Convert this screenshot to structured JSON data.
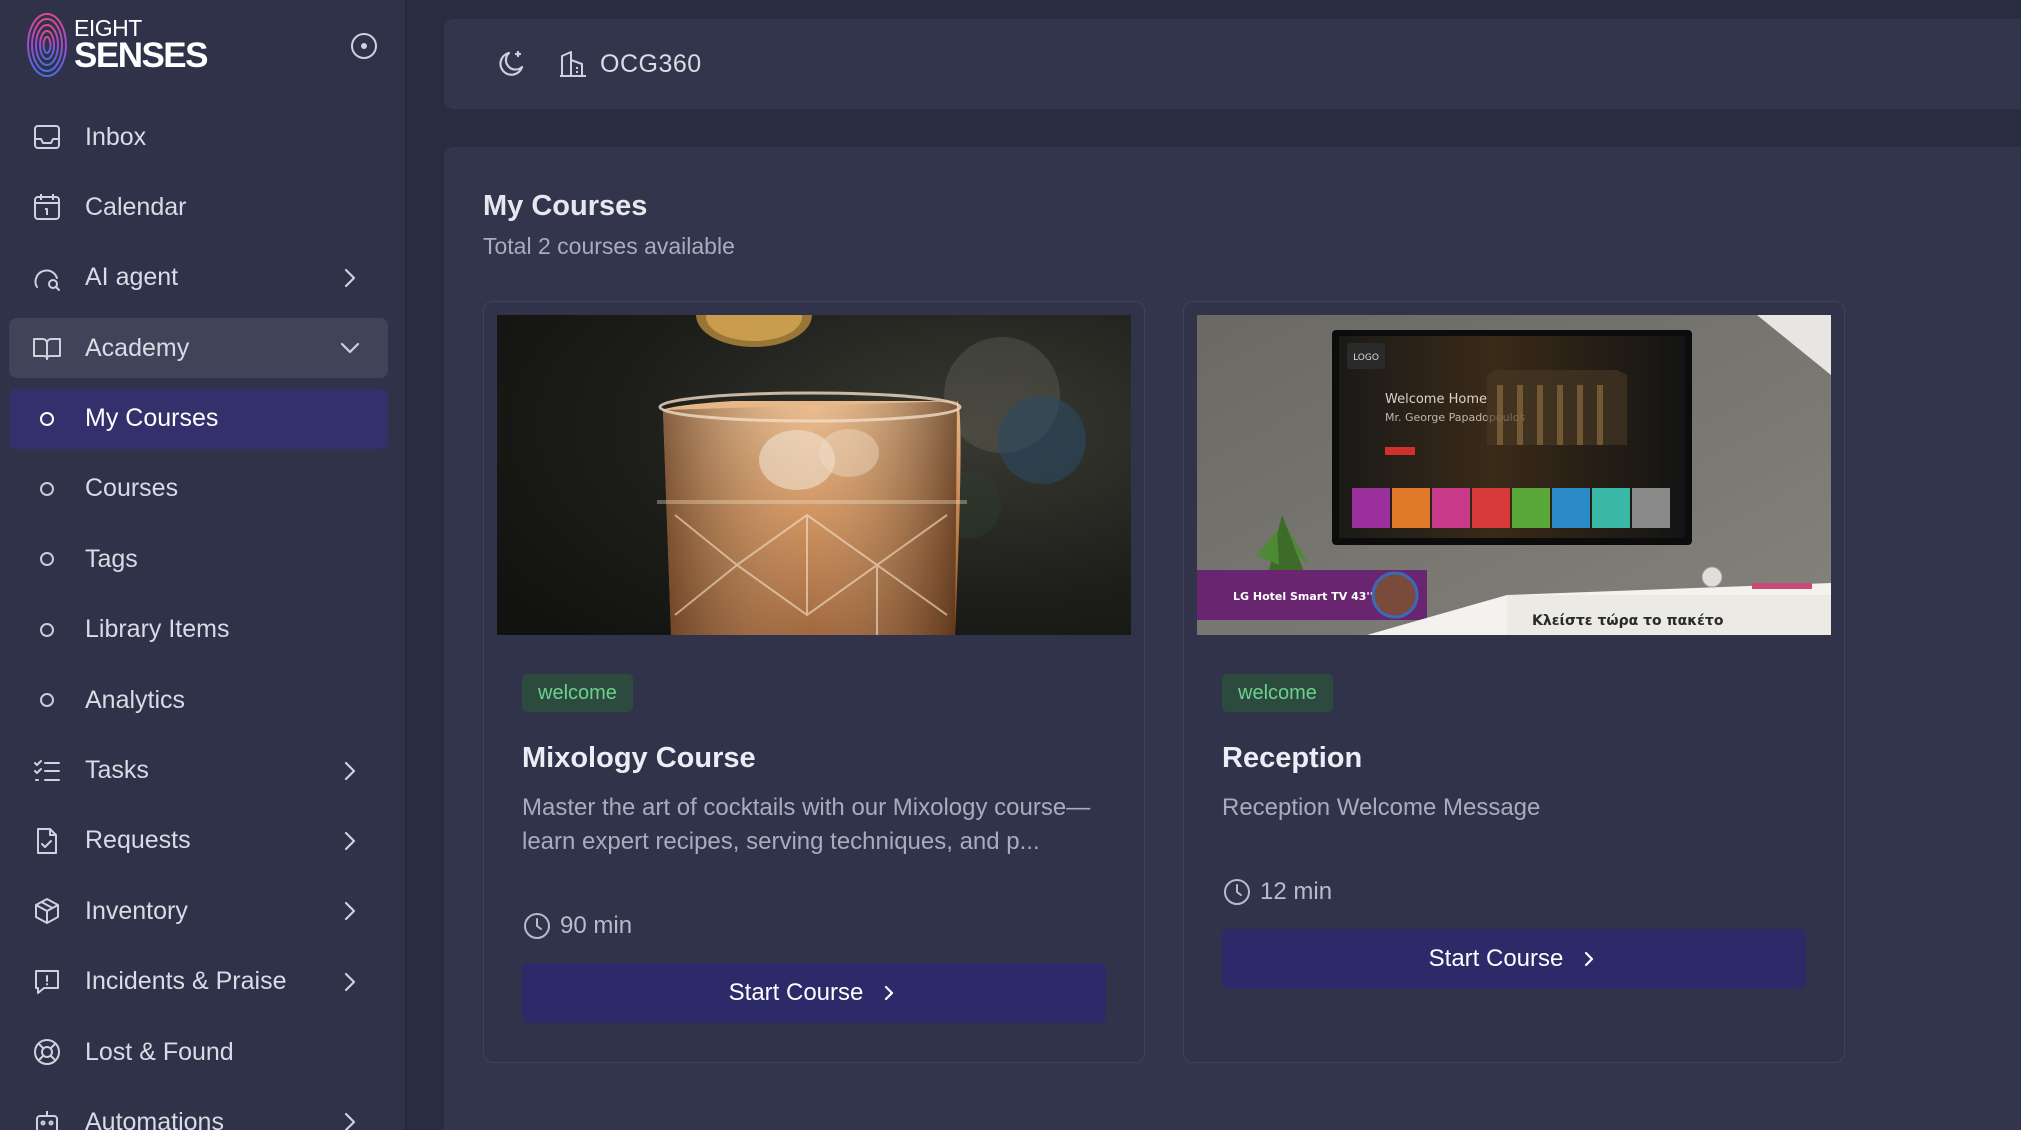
{
  "brand": {
    "line1": "EIGHT",
    "line2": "SENSES"
  },
  "header": {
    "org_name": "OCG360"
  },
  "sidebar": {
    "items": [
      {
        "label": "Inbox",
        "icon": "inbox-icon"
      },
      {
        "label": "Calendar",
        "icon": "calendar-icon"
      },
      {
        "label": "AI agent",
        "icon": "ai-agent-icon"
      },
      {
        "label": "Academy",
        "icon": "book-icon"
      },
      {
        "label": "My Courses"
      },
      {
        "label": "Courses"
      },
      {
        "label": "Tags"
      },
      {
        "label": "Library Items"
      },
      {
        "label": "Analytics"
      },
      {
        "label": "Tasks",
        "icon": "tasks-icon"
      },
      {
        "label": "Requests",
        "icon": "requests-icon"
      },
      {
        "label": "Inventory",
        "icon": "box-icon"
      },
      {
        "label": "Incidents & Praise",
        "icon": "message-alert-icon"
      },
      {
        "label": "Lost & Found",
        "icon": "lifebuoy-icon"
      },
      {
        "label": "Automations",
        "icon": "robot-icon"
      }
    ]
  },
  "main": {
    "title": "My Courses",
    "subtitle": "Total 2 courses available",
    "courses": [
      {
        "tag": "welcome",
        "title": "Mixology Course",
        "description": "Master the art of cocktails with our Mixology course—learn expert recipes, serving techniques, and p...",
        "duration": "90 min",
        "button": "Start Course"
      },
      {
        "tag": "welcome",
        "title": "Reception",
        "description": "Reception Welcome Message",
        "duration": "12 min",
        "button": "Start Course",
        "image_text": {
          "tv_logo": "LOGO",
          "tv_welcome": "Welcome Home",
          "tv_guest": "Mr. George Papadopoulos",
          "banner": "LG Hotel Smart TV 43''",
          "slogan": "Κλείστε τώρα το πακέτο"
        }
      }
    ]
  },
  "colors": {
    "sidebar_bg": "#2f3248",
    "panel_bg": "#32354c",
    "page_bg": "#2a2d42",
    "active_item_bg": "#33306b",
    "button_bg": "#2c2a68",
    "tag_bg": "#2d4a3e",
    "tag_text": "#6cd28a"
  }
}
